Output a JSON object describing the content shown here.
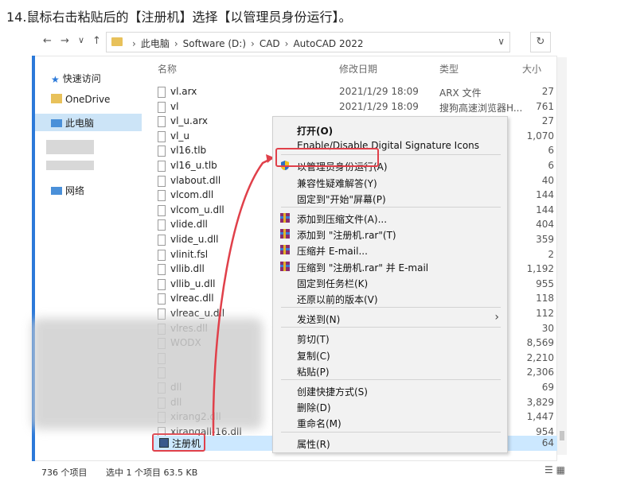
{
  "instruction": "14.鼠标右击粘贴后的【注册机】选择【以管理员身份运行】。",
  "toolbar": {
    "back": "←",
    "forward": "→",
    "down": "∨",
    "up": "↑",
    "breadcrumb": [
      "此电脑",
      "Software (D:)",
      "CAD",
      "AutoCAD 2022"
    ],
    "refresh": "↻"
  },
  "columns": {
    "name": "名称",
    "date": "修改日期",
    "type": "类型",
    "size": "大小"
  },
  "nav": [
    {
      "label": "快速访问"
    },
    {
      "label": "OneDrive"
    },
    {
      "label": "此电脑"
    },
    {
      "label": "网络"
    }
  ],
  "files": [
    {
      "name": "vl.arx",
      "date": "2021/1/29 18:09",
      "type": "ARX 文件",
      "size": "27"
    },
    {
      "name": "vl",
      "date": "2021/1/29 18:09",
      "type": "搜狗高速浏览器H...",
      "size": "761"
    },
    {
      "name": "vl_u.arx",
      "date": "",
      "type": "",
      "size": "27"
    },
    {
      "name": "vl_u",
      "date": "",
      "type": "",
      "size": "1,070"
    },
    {
      "name": "vl16.tlb",
      "date": "",
      "type": "",
      "size": "6"
    },
    {
      "name": "vl16_u.tlb",
      "date": "",
      "type": "",
      "size": "6"
    },
    {
      "name": "vlabout.dll",
      "date": "",
      "type": "",
      "size": "40"
    },
    {
      "name": "vlcom.dll",
      "date": "",
      "type": "",
      "size": "144"
    },
    {
      "name": "vlcom_u.dll",
      "date": "",
      "type": "",
      "size": "144"
    },
    {
      "name": "vlide.dll",
      "date": "",
      "type": "",
      "size": "404"
    },
    {
      "name": "vlide_u.dll",
      "date": "",
      "type": "",
      "size": "359"
    },
    {
      "name": "vlinit.fsl",
      "date": "",
      "type": "",
      "size": "2"
    },
    {
      "name": "vllib.dll",
      "date": "",
      "type": "",
      "size": "1,192"
    },
    {
      "name": "vllib_u.dll",
      "date": "",
      "type": "",
      "size": "955"
    },
    {
      "name": "vlreac.dll",
      "date": "",
      "type": "",
      "size": "118"
    },
    {
      "name": "vlreac_u.dll",
      "date": "",
      "type": "",
      "size": "112"
    },
    {
      "name": "vlres.dll",
      "date": "",
      "type": "",
      "size": "30"
    },
    {
      "name": "WODX",
      "date": "",
      "type": "",
      "size": "8,569"
    },
    {
      "name": "",
      "date": "",
      "type": "",
      "size": "2,210"
    },
    {
      "name": "",
      "date": "",
      "type": "",
      "size": "2,306"
    },
    {
      "name": "dll",
      "date": "",
      "type": "",
      "size": "69"
    },
    {
      "name": "dll",
      "date": "",
      "type": "",
      "size": "3,829"
    },
    {
      "name": "xirang2.dll",
      "date": "",
      "type": "",
      "size": "1,447"
    },
    {
      "name": "xirangall-16.dll",
      "date": "",
      "type": "",
      "size": "954"
    }
  ],
  "selected_file": {
    "name": "注册机",
    "size": "64"
  },
  "context_menu": {
    "items": [
      {
        "label": "打开(O)",
        "bold": true
      },
      {
        "label": "Enable/Disable Digital Signature Icons"
      },
      {
        "label": "以管理员身份运行(A)",
        "icon": "shield"
      },
      {
        "label": "兼容性疑难解答(Y)"
      },
      {
        "label": "固定到\"开始\"屏幕(P)"
      },
      {
        "label": "添加到压缩文件(A)...",
        "icon": "rar"
      },
      {
        "label": "添加到 \"注册机.rar\"(T)",
        "icon": "rar"
      },
      {
        "label": "压缩并 E-mail...",
        "icon": "rar"
      },
      {
        "label": "压缩到 \"注册机.rar\" 并 E-mail",
        "icon": "rar"
      },
      {
        "label": "固定到任务栏(K)"
      },
      {
        "label": "还原以前的版本(V)"
      },
      {
        "label": "发送到(N)"
      },
      {
        "label": "剪切(T)"
      },
      {
        "label": "复制(C)"
      },
      {
        "label": "粘贴(P)"
      },
      {
        "label": "创建快捷方式(S)"
      },
      {
        "label": "删除(D)"
      },
      {
        "label": "重命名(M)"
      },
      {
        "label": "属性(R)"
      }
    ]
  },
  "status": {
    "count": "736 个项目",
    "selected": "选中 1 个项目  63.5 KB"
  },
  "colors": {
    "highlight": "#e0404a",
    "selection": "#cce8ff",
    "accent": "#2b79d9"
  }
}
